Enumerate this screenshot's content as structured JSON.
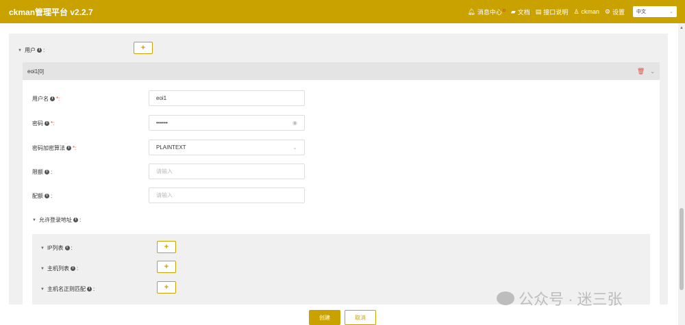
{
  "app": {
    "title": "ckman管理平台 v2.2.7"
  },
  "topnav": {
    "messages": "消息中心",
    "docs": "文档",
    "api": "接口说明",
    "user": "ckman",
    "settings": "设置",
    "language": "中文"
  },
  "form": {
    "users_label": "用户",
    "user_item": {
      "title": "eoi1[0]",
      "fields": {
        "username": {
          "label": "用户名",
          "value": "eoi1"
        },
        "password": {
          "label": "密码",
          "value": "••••••"
        },
        "encryption": {
          "label": "密码加密算法",
          "value": "PLAINTEXT"
        },
        "quota": {
          "label": "限额",
          "placeholder": "请输入"
        },
        "profile": {
          "label": "配额",
          "placeholder": "请输入"
        }
      },
      "allowed_hosts": {
        "label": "允许登录地址",
        "ip_list": "IP列表",
        "host_list": "主机列表",
        "host_regex": "主机名正则匹配"
      }
    },
    "colon": ":",
    "required_colon": "*:",
    "add_symbol": "+",
    "info_symbol": "i"
  },
  "footer": {
    "create": "创建",
    "cancel": "取消"
  },
  "watermark": {
    "text": "公众号 · 迷三张"
  },
  "colors": {
    "accent": "#c9a200",
    "danger": "#e74c3c"
  },
  "icons": [
    "bell-icon",
    "book-icon",
    "file-icon",
    "user-icon",
    "gear-icon",
    "chevron-down-icon",
    "trash-icon",
    "eye-icon",
    "info-icon",
    "caret-down-icon",
    "plus-icon",
    "wechat-icon"
  ]
}
